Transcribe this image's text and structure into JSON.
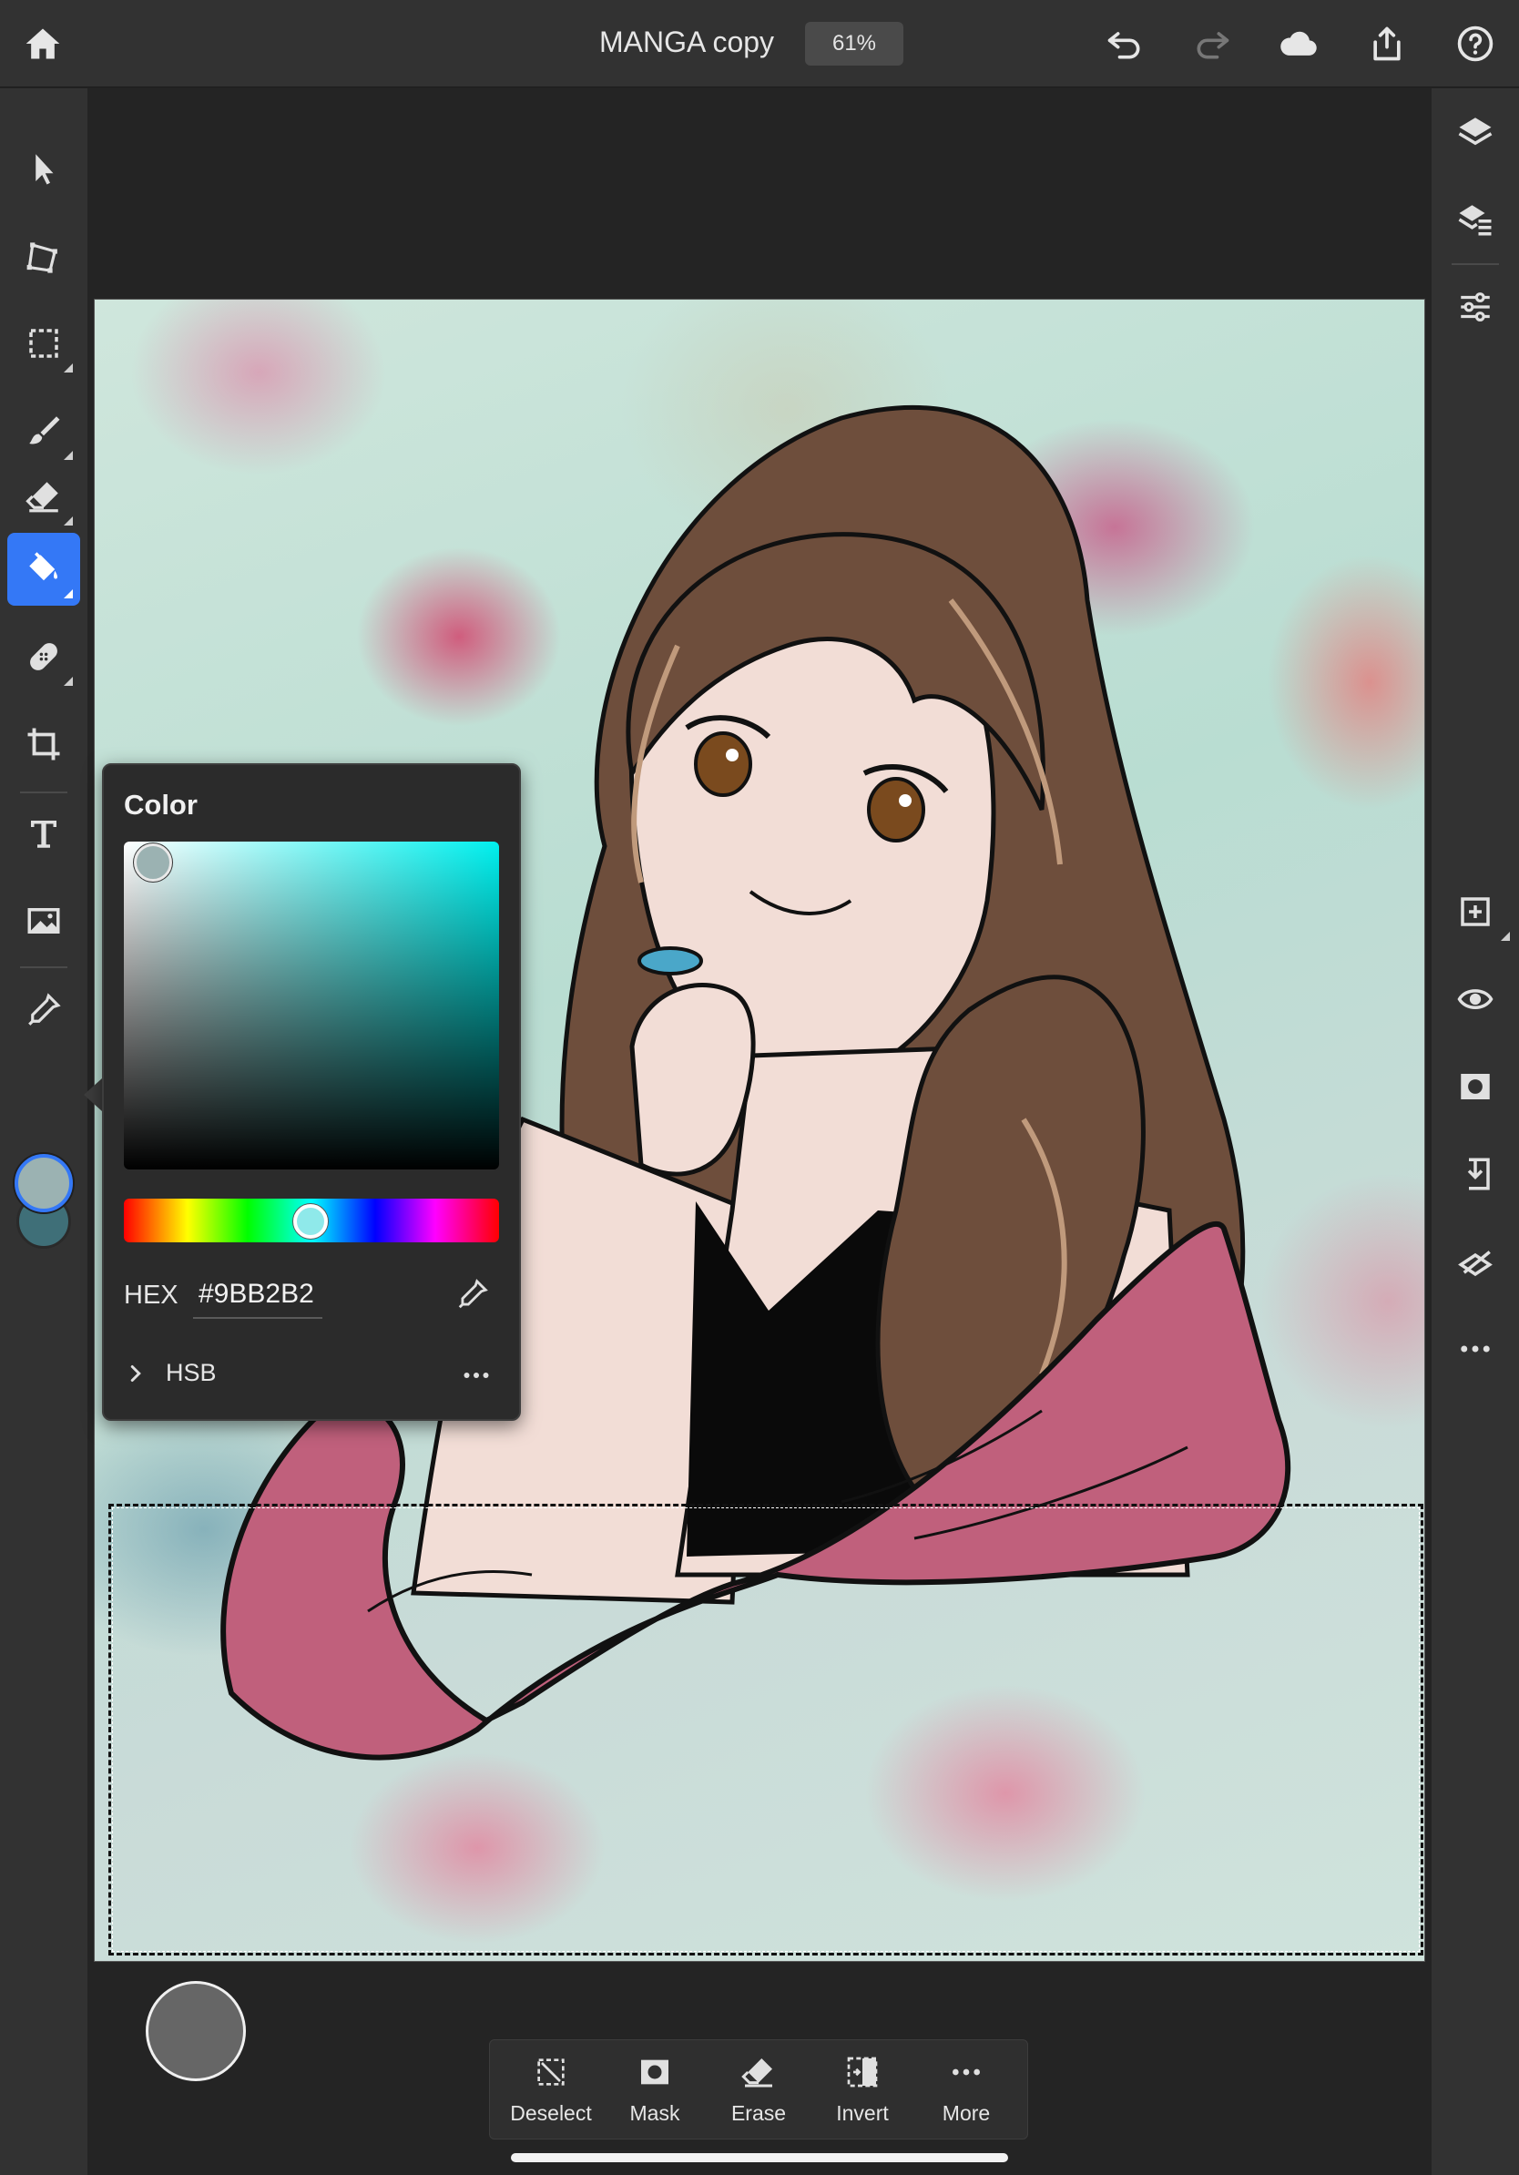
{
  "document": {
    "title": "MANGA copy",
    "zoom": "61%"
  },
  "color_panel": {
    "title": "Color",
    "hex_label": "HEX",
    "hex_value": "#9BB2B2",
    "mode_label": "HSB",
    "current_color": "#9BB2B2",
    "secondary_color": "#3F6F78",
    "hue_color": "#00F0EE"
  },
  "left_tools": [
    {
      "name": "select",
      "icon": "arrow-pointer-icon"
    },
    {
      "name": "transform",
      "icon": "transform-icon"
    },
    {
      "name": "selection",
      "icon": "marquee-icon"
    },
    {
      "name": "brush",
      "icon": "brush-icon"
    },
    {
      "name": "eraser",
      "icon": "eraser-icon"
    },
    {
      "name": "fill",
      "icon": "paint-bucket-icon",
      "active": true
    },
    {
      "name": "heal",
      "icon": "bandage-icon"
    },
    {
      "name": "crop",
      "icon": "crop-icon"
    },
    {
      "name": "type",
      "icon": "text-icon"
    },
    {
      "name": "place-image",
      "icon": "image-icon"
    },
    {
      "name": "eyedropper",
      "icon": "eyedropper-icon"
    }
  ],
  "right_tools": [
    {
      "name": "layers",
      "icon": "layers-icon"
    },
    {
      "name": "layer-properties",
      "icon": "layer-details-icon"
    },
    {
      "name": "adjustments",
      "icon": "sliders-icon"
    },
    {
      "name": "add-layer",
      "icon": "add-layer-icon"
    },
    {
      "name": "visibility",
      "icon": "eye-icon"
    },
    {
      "name": "mask",
      "icon": "mask-icon"
    },
    {
      "name": "import",
      "icon": "import-icon"
    },
    {
      "name": "clear",
      "icon": "clear-icon"
    },
    {
      "name": "more",
      "icon": "more-icon"
    }
  ],
  "task_bar": {
    "deselect": "Deselect",
    "mask": "Mask",
    "erase": "Erase",
    "invert": "Invert",
    "more": "More"
  }
}
